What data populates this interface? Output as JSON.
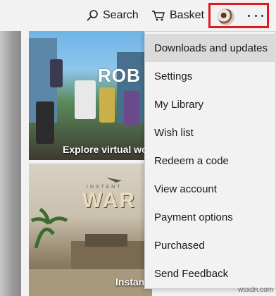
{
  "topbar": {
    "search_label": "Search",
    "basket_label": "Basket",
    "more_label": "···"
  },
  "tiles": [
    {
      "caption": "Explore virtual wo",
      "logo": "ROB"
    },
    {
      "caption": "Instan",
      "logo": "WAR",
      "small_logo": "INSTANT"
    }
  ],
  "menu": {
    "items": [
      {
        "label": "Downloads and updates",
        "active": true
      },
      {
        "label": "Settings"
      },
      {
        "label": "My Library"
      },
      {
        "label": "Wish list"
      },
      {
        "label": "Redeem a code"
      },
      {
        "label": "View account"
      },
      {
        "label": "Payment options"
      },
      {
        "label": "Purchased"
      },
      {
        "label": "Send Feedback"
      }
    ]
  },
  "watermark": "wsxdn.com",
  "colors": {
    "highlight_border": "#e0191f",
    "menu_background": "#f2f2f2",
    "menu_active": "#dadada"
  }
}
